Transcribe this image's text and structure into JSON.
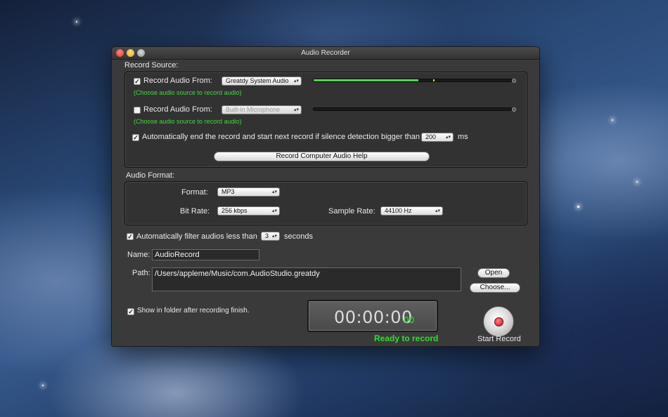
{
  "window": {
    "title": "Audio Recorder"
  },
  "record_source": {
    "section_label": "Record Source:",
    "source1": {
      "checked": true,
      "label": "Record Audio From:",
      "device": "Greatdy System Audio",
      "hint": "(Choose audio source to record audio)",
      "level": 0.53
    },
    "source2": {
      "checked": false,
      "label": "Record Audio From:",
      "device": "Built-in Microphone",
      "hint": "(Choose audio source to record audio)",
      "level": 0
    },
    "silence": {
      "checked": true,
      "label": "Automatically end the record and start next record if silence detection bigger than",
      "value": "200",
      "unit": "ms"
    },
    "help_button": "Record Computer Audio Help"
  },
  "audio_format": {
    "section_label": "Audio Format:",
    "format_label": "Format:",
    "format_value": "MP3",
    "bitrate_label": "Bit Rate:",
    "bitrate_value": "256 kbps",
    "samplerate_label": "Sample Rate:",
    "samplerate_value": "44100 Hz"
  },
  "filter": {
    "checked": true,
    "label": "Automatically filter audios less than",
    "value": "3",
    "unit": "seconds"
  },
  "name": {
    "label": "Name:",
    "value": "AudioRecord"
  },
  "path": {
    "label": "Path:",
    "value": "/Users/appleme/Music/com.AudioStudio.greatdy",
    "open_button": "Open",
    "choose_button": "Choose..."
  },
  "show_in_folder": {
    "checked": true,
    "label": "Show in folder after recording finish."
  },
  "timer": {
    "main": "00:00:00",
    "ms": "00"
  },
  "status": "Ready to record",
  "start_record_label": "Start Record",
  "colors": {
    "accent_green": "#2ee02e",
    "meter_green": "#3fcc3f",
    "record_red": "#c21a1a"
  }
}
